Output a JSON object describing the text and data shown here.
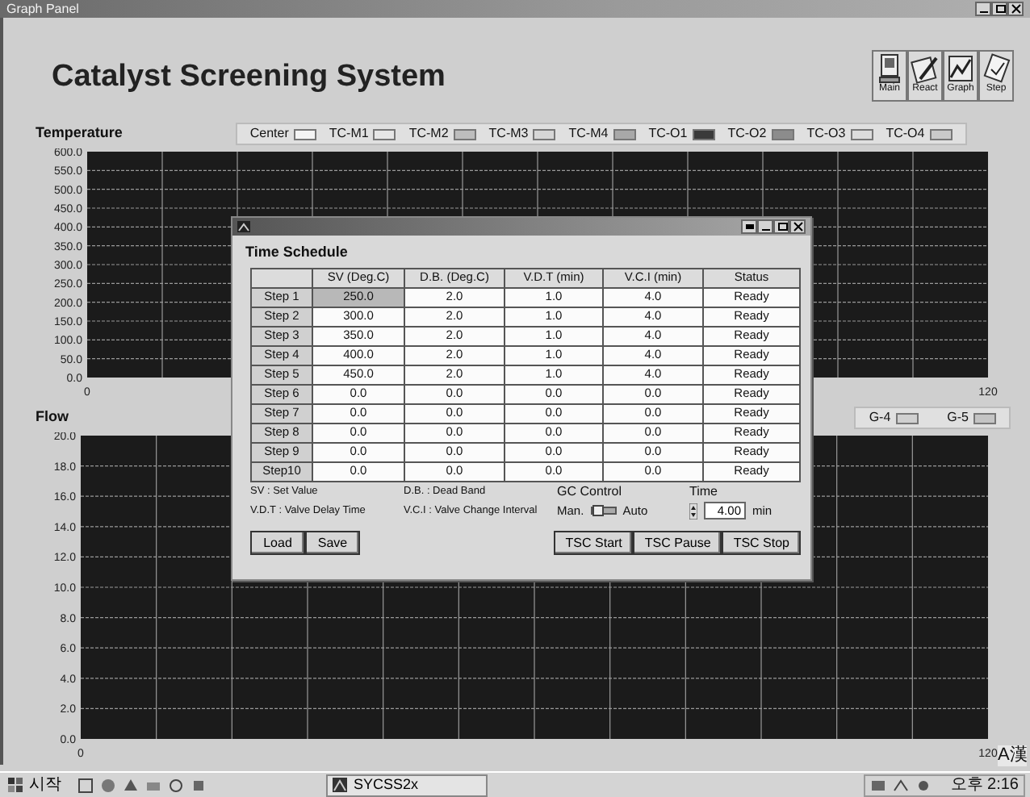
{
  "window": {
    "title": "Graph Panel"
  },
  "header": {
    "title": "Catalyst Screening System",
    "nav_buttons": [
      {
        "label": "Main",
        "kind": "computer"
      },
      {
        "label": "React",
        "kind": "pen"
      },
      {
        "label": "Graph",
        "kind": "graph"
      },
      {
        "label": "Step",
        "kind": "step"
      }
    ]
  },
  "temperature": {
    "title": "Temperature",
    "legend": [
      {
        "label": "Center",
        "color": "#f4f4f4"
      },
      {
        "label": "TC-M1",
        "color": "#e6e6e6"
      },
      {
        "label": "TC-M2",
        "color": "#bdbdbd"
      },
      {
        "label": "TC-M3",
        "color": "#d6d6d6"
      },
      {
        "label": "TC-M4",
        "color": "#a8a8a8"
      },
      {
        "label": "TC-O1",
        "color": "#3a3a3a"
      },
      {
        "label": "TC-O2",
        "color": "#8c8c8c"
      },
      {
        "label": "TC-O3",
        "color": "#dcdcdc"
      },
      {
        "label": "TC-O4",
        "color": "#cacaca"
      }
    ],
    "chart_data": {
      "type": "line",
      "grid": true,
      "xlim": [
        0,
        120
      ],
      "ylim": [
        0,
        600
      ],
      "xticks": [
        0,
        120
      ],
      "yticks": [
        {
          "value": 0,
          "label": "0.0"
        },
        {
          "value": 50,
          "label": "50.0"
        },
        {
          "value": 100,
          "label": "100.0"
        },
        {
          "value": 150,
          "label": "150.0"
        },
        {
          "value": 200,
          "label": "200.0"
        },
        {
          "value": 250,
          "label": "250.0"
        },
        {
          "value": 300,
          "label": "300.0"
        },
        {
          "value": 350,
          "label": "350.0"
        },
        {
          "value": 400,
          "label": "400.0"
        },
        {
          "value": 450,
          "label": "450.0"
        },
        {
          "value": 500,
          "label": "500.0"
        },
        {
          "value": 550,
          "label": "550.0"
        },
        {
          "value": 600,
          "label": "600.0"
        }
      ]
    }
  },
  "flow": {
    "title": "Flow",
    "legend": [
      {
        "label": "G-4",
        "color": "#d0d0d0"
      },
      {
        "label": "G-5",
        "color": "#c4c4c4"
      }
    ],
    "chart_data": {
      "type": "line",
      "grid": true,
      "xlim": [
        0,
        120
      ],
      "ylim": [
        0,
        20
      ],
      "xticks": [
        0,
        120
      ],
      "yticks": [
        {
          "value": 0,
          "label": "0.0"
        },
        {
          "value": 2,
          "label": "2.0"
        },
        {
          "value": 4,
          "label": "4.0"
        },
        {
          "value": 6,
          "label": "6.0"
        },
        {
          "value": 8,
          "label": "8.0"
        },
        {
          "value": 10,
          "label": "10.0"
        },
        {
          "value": 12,
          "label": "12.0"
        },
        {
          "value": 14,
          "label": "14.0"
        },
        {
          "value": 16,
          "label": "16.0"
        },
        {
          "value": 18,
          "label": "18.0"
        },
        {
          "value": 20,
          "label": "20.0"
        }
      ]
    }
  },
  "dialog": {
    "section_title": "Time Schedule",
    "columns": [
      "SV (Deg.C)",
      "D.B. (Deg.C)",
      "V.D.T (min)",
      "V.C.I (min)",
      "Status"
    ],
    "rows": [
      {
        "label": "Step 1",
        "cells": [
          "250.0",
          "2.0",
          "1.0",
          "4.0",
          "Ready"
        ],
        "selected": true
      },
      {
        "label": "Step 2",
        "cells": [
          "300.0",
          "2.0",
          "1.0",
          "4.0",
          "Ready"
        ],
        "selected": false
      },
      {
        "label": "Step 3",
        "cells": [
          "350.0",
          "2.0",
          "1.0",
          "4.0",
          "Ready"
        ],
        "selected": false
      },
      {
        "label": "Step 4",
        "cells": [
          "400.0",
          "2.0",
          "1.0",
          "4.0",
          "Ready"
        ],
        "selected": false
      },
      {
        "label": "Step 5",
        "cells": [
          "450.0",
          "2.0",
          "1.0",
          "4.0",
          "Ready"
        ],
        "selected": false
      },
      {
        "label": "Step 6",
        "cells": [
          "0.0",
          "0.0",
          "0.0",
          "0.0",
          "Ready"
        ],
        "selected": false
      },
      {
        "label": "Step 7",
        "cells": [
          "0.0",
          "0.0",
          "0.0",
          "0.0",
          "Ready"
        ],
        "selected": false
      },
      {
        "label": "Step 8",
        "cells": [
          "0.0",
          "0.0",
          "0.0",
          "0.0",
          "Ready"
        ],
        "selected": false
      },
      {
        "label": "Step 9",
        "cells": [
          "0.0",
          "0.0",
          "0.0",
          "0.0",
          "Ready"
        ],
        "selected": false
      },
      {
        "label": "Step10",
        "cells": [
          "0.0",
          "0.0",
          "0.0",
          "0.0",
          "Ready"
        ],
        "selected": false
      }
    ],
    "notes": [
      "SV : Set Value",
      "D.B. : Dead Band",
      "V.D.T : Valve Delay Time",
      "V.C.I : Valve Change Interval"
    ],
    "gc_control": {
      "label": "GC Control",
      "off_label": "Man.",
      "on_label": "Auto",
      "auto": false
    },
    "time": {
      "label": "Time",
      "value": "4.00",
      "unit": "min"
    },
    "buttons_left": [
      "Load",
      "Save"
    ],
    "buttons_right": [
      "TSC Start",
      "TSC Pause",
      "TSC Stop"
    ]
  },
  "ime_indicator": "A漢",
  "taskbar": {
    "start": "시작",
    "task": "SYCSS2x",
    "clock": "오후 2:16"
  }
}
